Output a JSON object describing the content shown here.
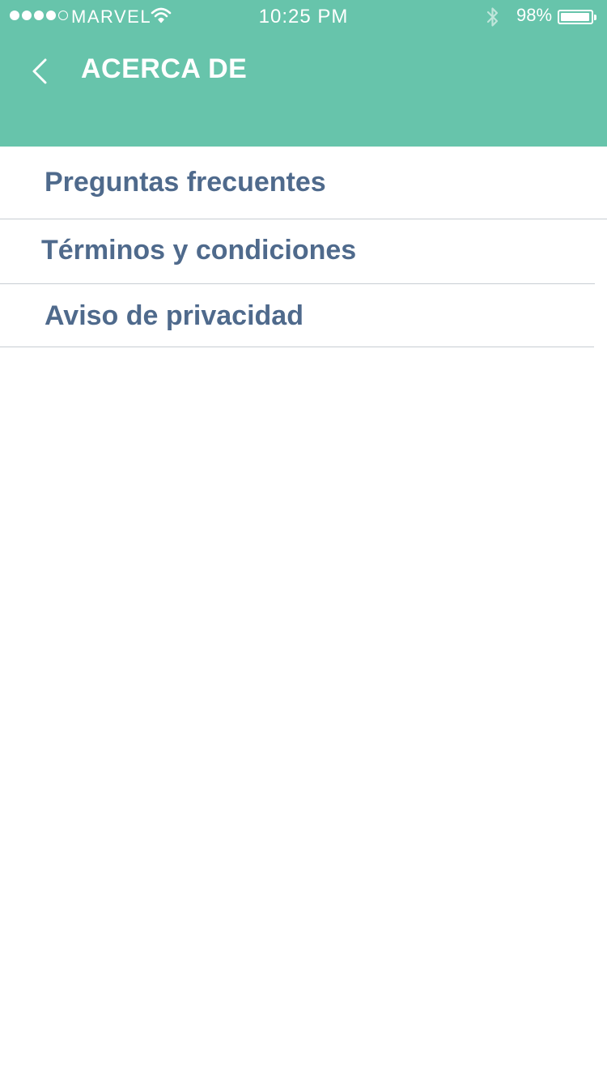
{
  "status_bar": {
    "carrier": "MARVEL",
    "time": "10:25 PM",
    "battery_percent": "98%",
    "battery_level": 0.98,
    "signal_bars": 4,
    "signal_max": 5,
    "icons": [
      "wifi-icon",
      "bluetooth-icon",
      "battery-icon"
    ]
  },
  "header": {
    "title": "ACERCA DE",
    "back_icon": "chevron-left-icon",
    "background_color": "#67c4ab"
  },
  "menu": {
    "items": [
      {
        "label": "Preguntas frecuentes"
      },
      {
        "label": "Términos y condiciones"
      },
      {
        "label": "Aviso de privacidad"
      }
    ],
    "text_color": "#4f6a8c"
  }
}
